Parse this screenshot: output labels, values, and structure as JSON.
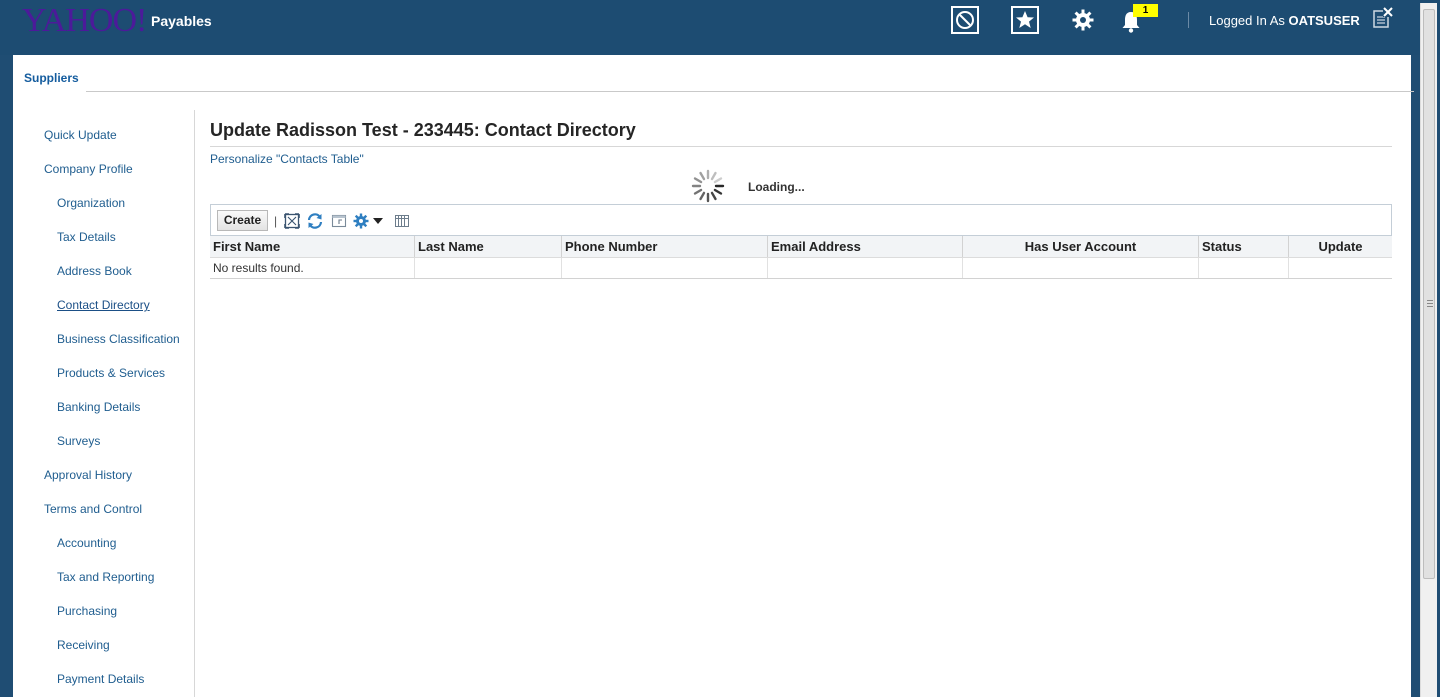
{
  "header": {
    "logo": "YAHOO!",
    "app_name": "Payables",
    "notification_count": "1",
    "logged_in_prefix": "Logged In As",
    "username": "OATSUSER",
    "icons": [
      "compass-icon",
      "favorites-star-icon",
      "settings-gear-icon",
      "notifications-bell-icon",
      "signout-icon"
    ]
  },
  "tabs": {
    "active": "Suppliers"
  },
  "nav": {
    "items": [
      {
        "label": "Quick Update",
        "level": 1
      },
      {
        "label": "Company Profile",
        "level": 1
      },
      {
        "label": "Organization",
        "level": 2
      },
      {
        "label": "Tax Details",
        "level": 2
      },
      {
        "label": "Address Book",
        "level": 2
      },
      {
        "label": "Contact Directory",
        "level": 2,
        "active": true
      },
      {
        "label": "Business Classification",
        "level": 2
      },
      {
        "label": "Products & Services",
        "level": 2
      },
      {
        "label": "Banking Details",
        "level": 2
      },
      {
        "label": "Surveys",
        "level": 2
      },
      {
        "label": "Approval History",
        "level": 1
      },
      {
        "label": "Terms and Control",
        "level": 1
      },
      {
        "label": "Accounting",
        "level": 2
      },
      {
        "label": "Tax and Reporting",
        "level": 2
      },
      {
        "label": "Purchasing",
        "level": 2
      },
      {
        "label": "Receiving",
        "level": 2
      },
      {
        "label": "Payment Details",
        "level": 2
      }
    ]
  },
  "main": {
    "title": "Update Radisson Test - 233445: Contact Directory",
    "personalize_link": "Personalize \"Contacts Table\"",
    "loading_text": "Loading...",
    "toolbar": {
      "create_label": "Create",
      "separator": "|",
      "icons": [
        "detach-icon",
        "refresh-icon",
        "export-icon",
        "settings-icon",
        "view-columns-icon"
      ]
    },
    "table": {
      "columns": [
        "First Name",
        "Last Name",
        "Phone Number",
        "Email Address",
        "Has User Account",
        "Status",
        "Update"
      ],
      "empty_message": "No results found."
    }
  },
  "colors": {
    "header_bg": "#1d4c72",
    "logo": "#4c1a9a",
    "link": "#1f5d8f",
    "badge": "#ffff00"
  }
}
